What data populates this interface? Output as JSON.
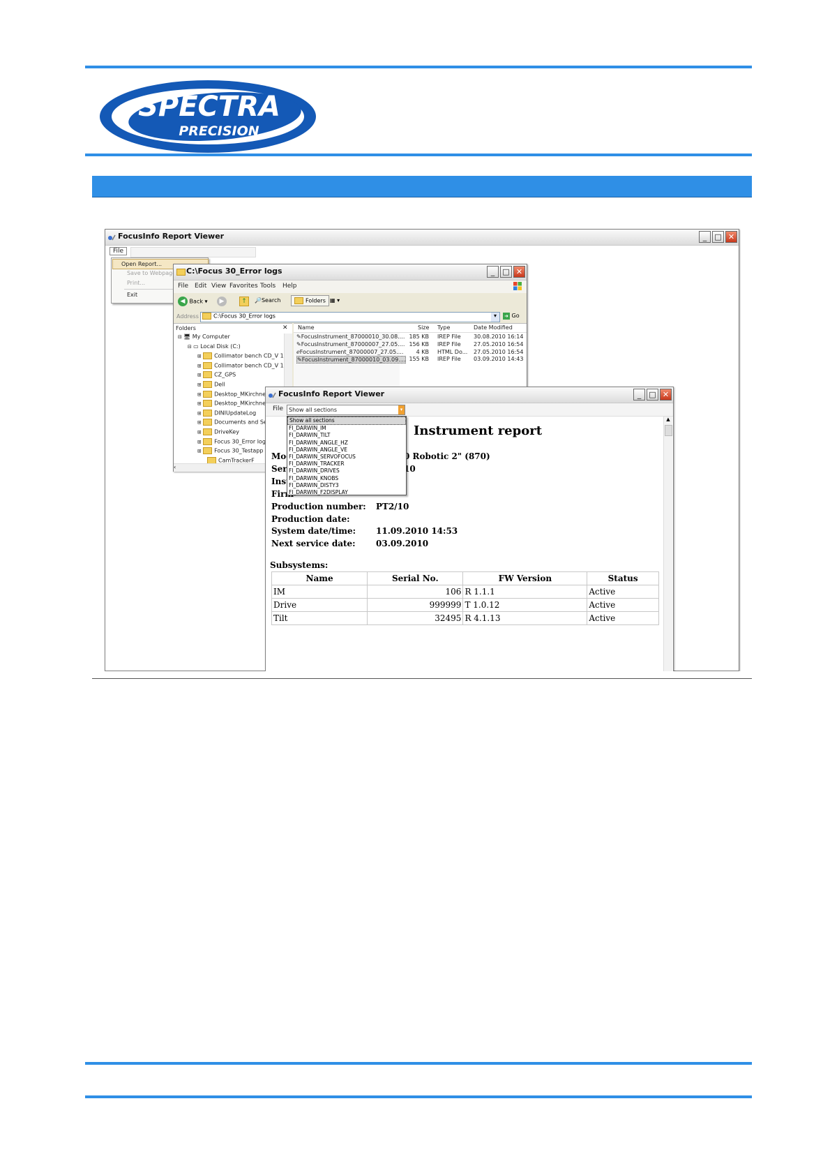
{
  "brand": {
    "name": "SPECTRA",
    "sub": "PRECISION",
    "accent": "#2f8fe6",
    "dark": "#1459b6"
  },
  "main_window": {
    "title": "FocusInfo Report Viewer",
    "menu": "File",
    "file_menu": [
      "Open Report...",
      "Save to Webpage...",
      "Print...",
      "Exit"
    ]
  },
  "explorer": {
    "title": "C:\\Focus 30_Error logs",
    "menu": [
      "File",
      "Edit",
      "View",
      "Favorites",
      "Tools",
      "Help"
    ],
    "toolbar": {
      "back": "Back",
      "search": "Search",
      "folders": "Folders"
    },
    "address_label": "Address",
    "address": "C:\\Focus 30_Error logs",
    "go": "Go",
    "folders_label": "Folders",
    "tree": [
      {
        "label": "My Computer",
        "indent": 0
      },
      {
        "label": "Local Disk (C:)",
        "indent": 1
      },
      {
        "label": "Collimator bench CD_V 1.",
        "indent": 2
      },
      {
        "label": "Collimator bench CD_V 1.",
        "indent": 2
      },
      {
        "label": "CZ_GPS",
        "indent": 2
      },
      {
        "label": "Dell",
        "indent": 2
      },
      {
        "label": "Desktop_MKirchne",
        "indent": 2
      },
      {
        "label": "Desktop_MKirchne",
        "indent": 2
      },
      {
        "label": "DINIUpdateLog",
        "indent": 2
      },
      {
        "label": "Documents and Se",
        "indent": 2
      },
      {
        "label": "DriveKey",
        "indent": 2
      },
      {
        "label": "Focus 30_Error log",
        "indent": 2
      },
      {
        "label": "Focus 30_Testapp",
        "indent": 2
      },
      {
        "label": "CamTrackerF",
        "indent": 3
      }
    ],
    "columns": [
      "Name",
      "Size",
      "Type",
      "Date Modified"
    ],
    "files": [
      {
        "name": "FocusInstrument_87000010_30.08....",
        "size": "185 KB",
        "type": "IREP File",
        "date": "30.08.2010 16:14"
      },
      {
        "name": "FocusInstrument_87000007_27.05....",
        "size": "156 KB",
        "type": "IREP File",
        "date": "27.05.2010 16:54"
      },
      {
        "name": "FocusInstrument_87000007_27.05....",
        "size": "4 KB",
        "type": "HTML Do...",
        "date": "27.05.2010 16:54"
      },
      {
        "name": "FocusInstrument_87000010_03.09....",
        "size": "155 KB",
        "type": "IREP File",
        "date": "03.09.2010 14:43"
      }
    ]
  },
  "viewer": {
    "title": "FocusInfo Report Viewer",
    "menu": "File",
    "select_value": "Show all sections",
    "dropdown": [
      "Show all sections",
      "FI_DARWIN_IM",
      "FI_DARWIN_TILT",
      "FI_DARWIN_ANGLE_HZ",
      "FI_DARWIN_ANGLE_VE",
      "FI_DARWIN_SERVOFOCUS",
      "FI_DARWIN_TRACKER",
      "FI_DARWIN_DRIVES",
      "FI_DARWIN_KNOBS",
      "FI_DARWIN_DISTY3",
      "FI_DARWIN_F2DISPLAY"
    ],
    "report_title": "Instrument report",
    "partial_labels": [
      "Moc",
      "Seri",
      "Inst",
      "Firm"
    ],
    "partial_values": [
      "0 Robotic 2\" (870)",
      "10"
    ],
    "fields": [
      {
        "label": "Production number:",
        "value": "PT2/10"
      },
      {
        "label": "Production date:",
        "value": ""
      },
      {
        "label": "System date/time:",
        "value": "11.09.2010 14:53"
      },
      {
        "label": "Next service date:",
        "value": "03.09.2010"
      }
    ],
    "subsystems_label": "Subsystems:",
    "table_headers": [
      "Name",
      "Serial No.",
      "FW Version",
      "Status"
    ],
    "rows": [
      {
        "name": "IM",
        "serial": "106",
        "fw": "R 1.1.1",
        "status": "Active"
      },
      {
        "name": "Drive",
        "serial": "999999",
        "fw": "T 1.0.12",
        "status": "Active"
      },
      {
        "name": "Tilt",
        "serial": "32495",
        "fw": "R 4.1.13",
        "status": "Active"
      }
    ]
  }
}
